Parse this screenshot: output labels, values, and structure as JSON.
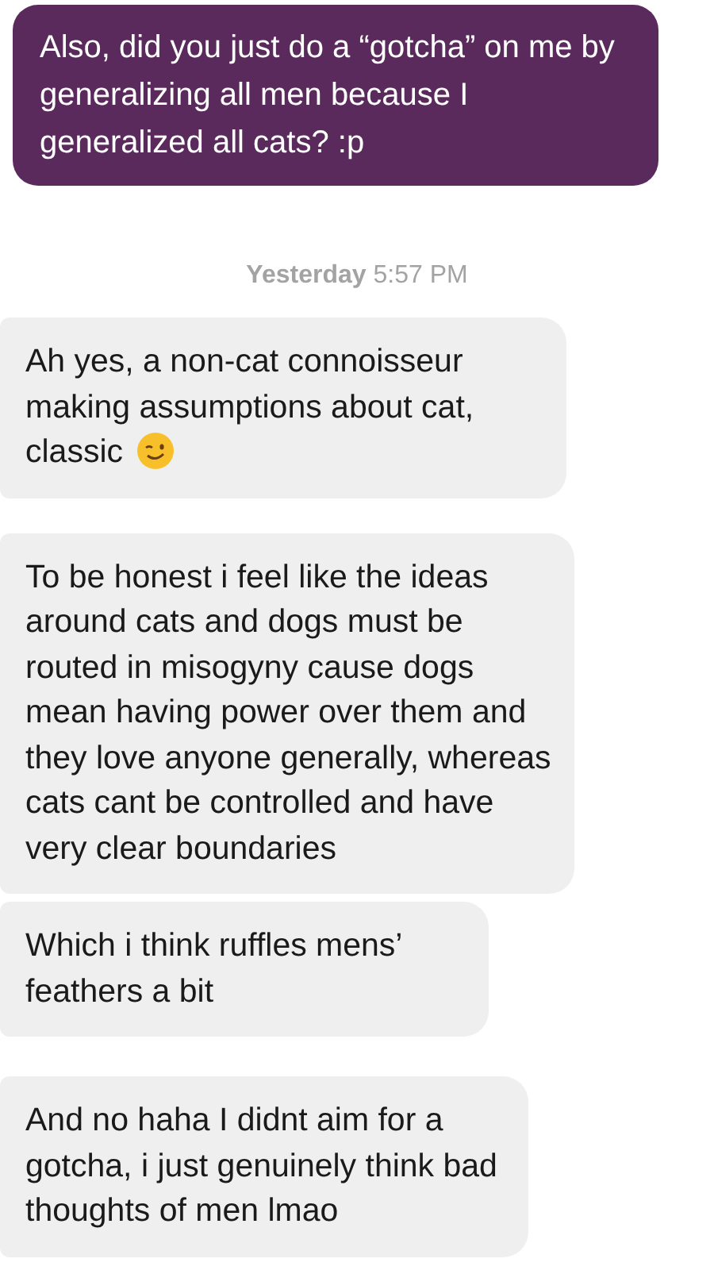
{
  "messages": [
    {
      "kind": "outgoing",
      "text": "Also, did you just do a “gotcha” on me by generalizing all men because I generalized all cats? :p"
    },
    {
      "kind": "timestamp",
      "day": "Yesterday",
      "time": "5:57 PM"
    },
    {
      "kind": "incoming",
      "text": "Ah yes, a non-cat connoisseur making assumptions about cat, classic",
      "emoji": true
    },
    {
      "kind": "incoming",
      "text": "To be honest i feel like the ideas around cats and dogs must be routed in misogyny cause dogs mean having power over them and they love anyone generally, whereas cats cant be controlled and have very clear boundaries"
    },
    {
      "kind": "incoming",
      "text": "Which i think ruffles mens’ feathers a bit"
    },
    {
      "kind": "incoming",
      "text": "And no haha I didnt aim for a gotcha, i just genuinely think bad thoughts of men lmao"
    }
  ]
}
